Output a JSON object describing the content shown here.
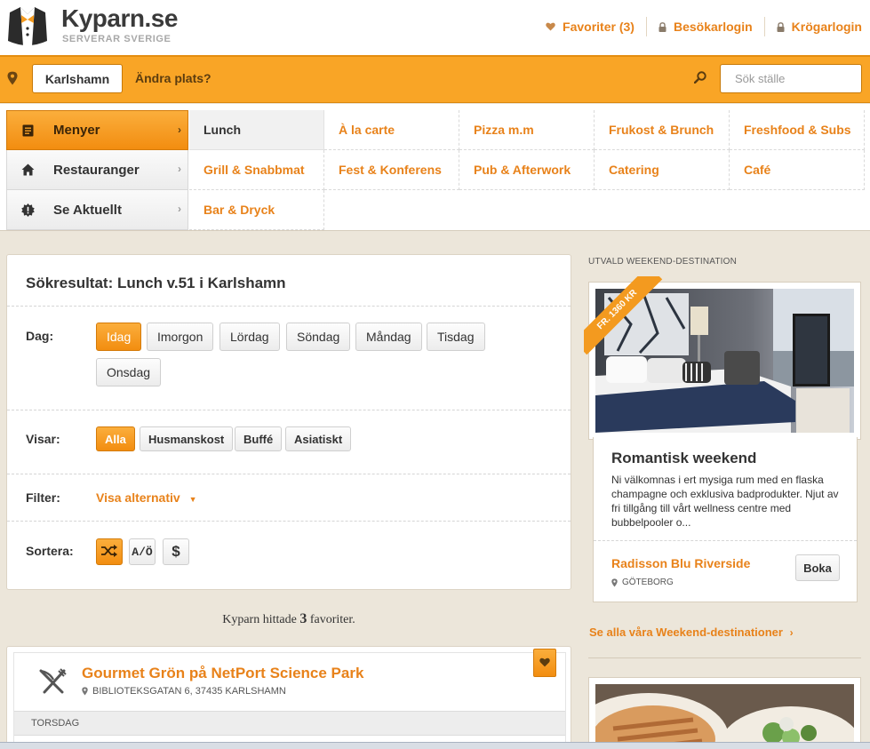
{
  "brand": {
    "name": "Kyparn.se",
    "tagline": "SERVERAR SVERIGE"
  },
  "top_links": [
    {
      "label": "Favoriter (3)",
      "icon": "heart-icon"
    },
    {
      "label": "Besökarlogin",
      "icon": "lock-icon"
    },
    {
      "label": "Krögarlogin",
      "icon": "lock-icon"
    }
  ],
  "location": {
    "city": "Karlshamn",
    "change_label": "Ändra plats?",
    "search_placeholder": "Sök ställe"
  },
  "sidenav": [
    {
      "label": "Menyer",
      "icon": "menu-book-icon",
      "active": true
    },
    {
      "label": "Restauranger",
      "icon": "home-icon",
      "active": false
    },
    {
      "label": "Se Aktuellt",
      "icon": "alert-badge-icon",
      "active": false
    }
  ],
  "categories": [
    "Lunch",
    "À la carte",
    "Pizza m.m",
    "Frukost & Brunch",
    "Freshfood & Subs",
    "Grill & Snabbmat",
    "Fest & Konferens",
    "Pub & Afterwork",
    "Catering",
    "Café",
    "Bar & Dryck"
  ],
  "search_panel": {
    "title": "Sökresultat: Lunch v.51 i Karlshamn",
    "day_label": "Dag:",
    "days": [
      "Idag",
      "Imorgon",
      "Lördag",
      "Söndag",
      "Måndag",
      "Tisdag",
      "Onsdag"
    ],
    "show_label": "Visar:",
    "types": [
      "Alla",
      "Husmanskost",
      "Buffé",
      "Asiatiskt"
    ],
    "filter_label": "Filter:",
    "filter_link": "Visa alternativ",
    "sort_label": "Sortera:",
    "sort_options": [
      "shuffle-icon",
      "A/Ö",
      "$"
    ]
  },
  "found": {
    "prefix": "Kyparn hittade",
    "count": "3",
    "suffix": "favoriter."
  },
  "restaurant": {
    "name": "Gourmet Grön på NetPort Science Park",
    "address": "BIBLIOTEKSGATAN 6, 37435 KARLSHAMN",
    "day": "TORSDAG"
  },
  "featured": {
    "section_label": "UTVALD WEEKEND-DESTINATION",
    "ribbon": "FR. 1360 KR",
    "title": "Romantisk weekend",
    "description": "Ni välkomnas i ert mysiga rum med en flaska champagne och exklusiva badprodukter. Njut av fri tillgång till vårt wellness centre med bubbelpooler o...",
    "hotel": "Radisson Blu Riverside",
    "city": "GÖTEBORG",
    "book_label": "Boka",
    "see_all": "Se alla våra Weekend-destinationer"
  },
  "colors": {
    "accent": "#f9a526",
    "link": "#e8821a",
    "page_bg": "#ece6da"
  }
}
